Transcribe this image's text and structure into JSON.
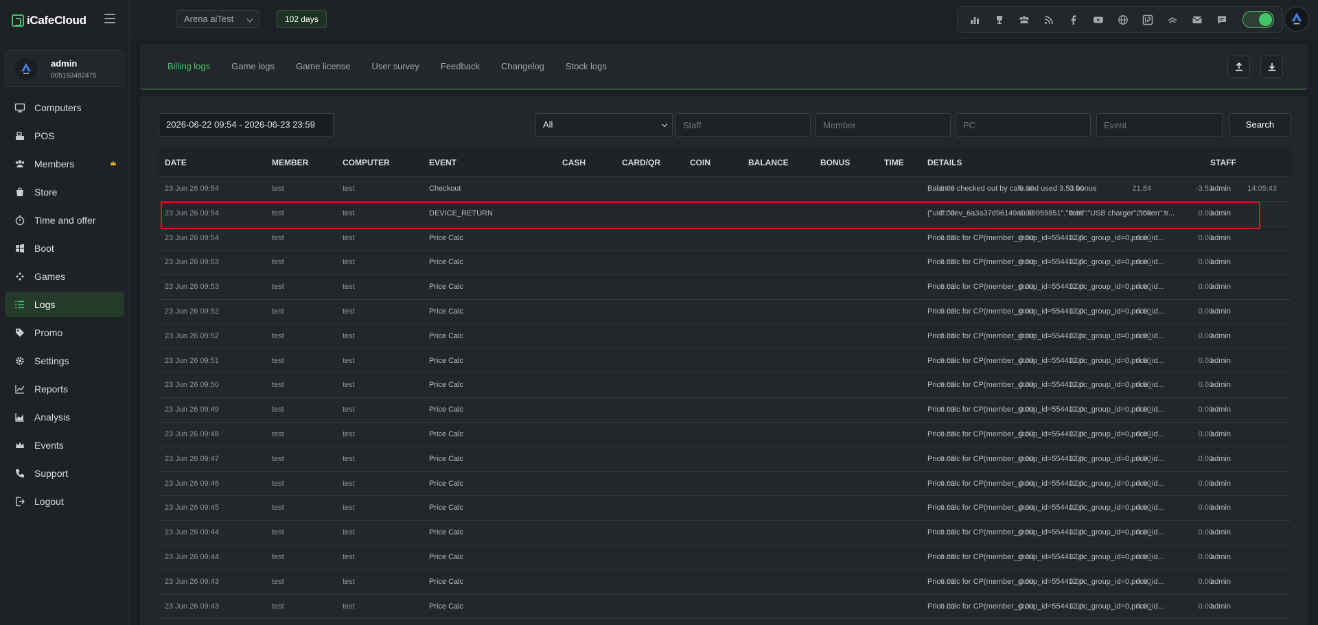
{
  "app": {
    "name": "iCafeCloud"
  },
  "profile": {
    "name": "admin",
    "id": "005193482475"
  },
  "sidebar": {
    "items": [
      {
        "label": "Computers",
        "icon": "monitor-icon"
      },
      {
        "label": "POS",
        "icon": "cash-register-icon"
      },
      {
        "label": "Members",
        "icon": "users-icon"
      },
      {
        "label": "Store",
        "icon": "shopping-bag-icon"
      },
      {
        "label": "Time and offer",
        "icon": "stopwatch-icon"
      },
      {
        "label": "Boot",
        "icon": "windows-icon"
      },
      {
        "label": "Games",
        "icon": "gamepad-icon"
      },
      {
        "label": "Logs",
        "icon": "list-icon"
      },
      {
        "label": "Promo",
        "icon": "tag-icon"
      },
      {
        "label": "Settings",
        "icon": "gear-icon"
      },
      {
        "label": "Reports",
        "icon": "line-chart-icon"
      },
      {
        "label": "Analysis",
        "icon": "area-chart-icon"
      },
      {
        "label": "Events",
        "icon": "crown-icon"
      },
      {
        "label": "Support",
        "icon": "phone-icon"
      },
      {
        "label": "Logout",
        "icon": "logout-icon"
      }
    ],
    "active": "Logs"
  },
  "topbar": {
    "store": "Arena aiTest",
    "days": "102 days"
  },
  "tabs": [
    "Billing logs",
    "Game logs",
    "Game license",
    "User survey",
    "Feedback",
    "Changelog",
    "Stock logs"
  ],
  "filters": {
    "date_range": "2026-06-22 09:54 - 2026-06-23 23:59",
    "type_selected": "All",
    "staff_placeholder": "Staff",
    "member_placeholder": "Member",
    "pc_placeholder": "PC",
    "event_placeholder": "Event",
    "search_label": "Search"
  },
  "table": {
    "columns": [
      "DATE",
      "MEMBER",
      "COMPUTER",
      "EVENT",
      "CASH",
      "CARD/QR",
      "COIN",
      "BALANCE",
      "BONUS",
      "TIME",
      "DETAILS",
      "STAFF"
    ],
    "rows": [
      [
        "23 Jun 26 09:54",
        "test",
        "test",
        "Checkout",
        "0.00",
        "0.00",
        "0.00",
        "21.84",
        "-3.53",
        "14:05:43",
        "Balance checked out by cafe and used 3.53 bonus",
        "admin"
      ],
      [
        "23 Jun 26 09:54",
        "test",
        "test",
        "DEVICE_RETURN",
        "0.00",
        "0.00",
        "0.00",
        "0.00",
        "0.00",
        "",
        "{\"uid\":\"dev_6a3a37d96149a0.60959851\",\"item\":\"USB charger\",\"token\":tr...",
        "admin"
      ],
      [
        "23 Jun 26 09:54",
        "test",
        "test",
        "Price Calc",
        "0.00",
        "0.00",
        "0.00",
        "0.00",
        "0.00",
        "",
        "Price calc for CP(member_group_id=554412,pc_group_id=0,price_id...",
        "admin"
      ],
      [
        "23 Jun 26 09:53",
        "test",
        "test",
        "Price Calc",
        "0.00",
        "0.00",
        "0.00",
        "0.00",
        "0.00",
        "",
        "Price calc for CP(member_group_id=554412,pc_group_id=0,price_id...",
        "admin"
      ],
      [
        "23 Jun 26 09:53",
        "test",
        "test",
        "Price Calc",
        "0.00",
        "0.00",
        "0.00",
        "0.00",
        "0.00",
        "",
        "Price calc for CP(member_group_id=554412,pc_group_id=0,price_id...",
        "admin"
      ],
      [
        "23 Jun 26 09:52",
        "test",
        "test",
        "Price Calc",
        "0.00",
        "0.00",
        "0.00",
        "0.00",
        "0.00",
        "",
        "Price calc for CP(member_group_id=554412,pc_group_id=0,price_id...",
        "admin"
      ],
      [
        "23 Jun 26 09:52",
        "test",
        "test",
        "Price Calc",
        "0.00",
        "0.00",
        "0.00",
        "0.00",
        "0.00",
        "",
        "Price calc for CP(member_group_id=554412,pc_group_id=0,price_id...",
        "admin"
      ],
      [
        "23 Jun 26 09:51",
        "test",
        "test",
        "Price Calc",
        "0.00",
        "0.00",
        "0.00",
        "0.00",
        "0.00",
        "",
        "Price calc for CP(member_group_id=554412,pc_group_id=0,price_id...",
        "admin"
      ],
      [
        "23 Jun 26 09:50",
        "test",
        "test",
        "Price Calc",
        "0.00",
        "0.00",
        "0.00",
        "0.00",
        "0.00",
        "",
        "Price calc for CP(member_group_id=554412,pc_group_id=0,price_id...",
        "admin"
      ],
      [
        "23 Jun 26 09:49",
        "test",
        "test",
        "Price Calc",
        "0.00",
        "0.00",
        "0.00",
        "0.00",
        "0.00",
        "",
        "Price calc for CP(member_group_id=554412,pc_group_id=0,price_id...",
        "admin"
      ],
      [
        "23 Jun 26 09:48",
        "test",
        "test",
        "Price Calc",
        "0.00",
        "0.00",
        "0.00",
        "0.00",
        "0.00",
        "",
        "Price calc for CP(member_group_id=554412,pc_group_id=0,price_id...",
        "admin"
      ],
      [
        "23 Jun 26 09:47",
        "test",
        "test",
        "Price Calc",
        "0.00",
        "0.00",
        "0.00",
        "0.00",
        "0.00",
        "",
        "Price calc for CP(member_group_id=554412,pc_group_id=0,price_id...",
        "admin"
      ],
      [
        "23 Jun 26 09:46",
        "test",
        "test",
        "Price Calc",
        "0.00",
        "0.00",
        "0.00",
        "0.00",
        "0.00",
        "",
        "Price calc for CP(member_group_id=554412,pc_group_id=0,price_id...",
        "admin"
      ],
      [
        "23 Jun 26 09:45",
        "test",
        "test",
        "Price Calc",
        "0.00",
        "0.00",
        "0.00",
        "0.00",
        "0.00",
        "",
        "Price calc for CP(member_group_id=554412,pc_group_id=0,price_id...",
        "admin"
      ],
      [
        "23 Jun 26 09:44",
        "test",
        "test",
        "Price Calc",
        "0.00",
        "0.00",
        "0.00",
        "0.00",
        "0.00",
        "",
        "Price calc for CP(member_group_id=554412,pc_group_id=0,price_id...",
        "admin"
      ],
      [
        "23 Jun 26 09:44",
        "test",
        "test",
        "Price Calc",
        "0.00",
        "0.00",
        "0.00",
        "0.00",
        "0.00",
        "",
        "Price calc for CP(member_group_id=554412,pc_group_id=0,price_id...",
        "admin"
      ],
      [
        "23 Jun 26 09:43",
        "test",
        "test",
        "Price Calc",
        "0.00",
        "0.00",
        "0.00",
        "0.00",
        "0.00",
        "",
        "Price calc for CP(member_group_id=554412,pc_group_id=0,price_id...",
        "admin"
      ],
      [
        "23 Jun 26 09:43",
        "test",
        "test",
        "Price Calc",
        "0.00",
        "0.00",
        "0.00",
        "0.00",
        "0.00",
        "",
        "Price calc for CP(member_group_id=554412,pc_group_id=0,price_id...",
        "admin"
      ]
    ],
    "highlighted_row": 1
  },
  "colors": {
    "accent": "#43c56a",
    "highlight": "#d5151a",
    "background": "#1b1e22"
  }
}
